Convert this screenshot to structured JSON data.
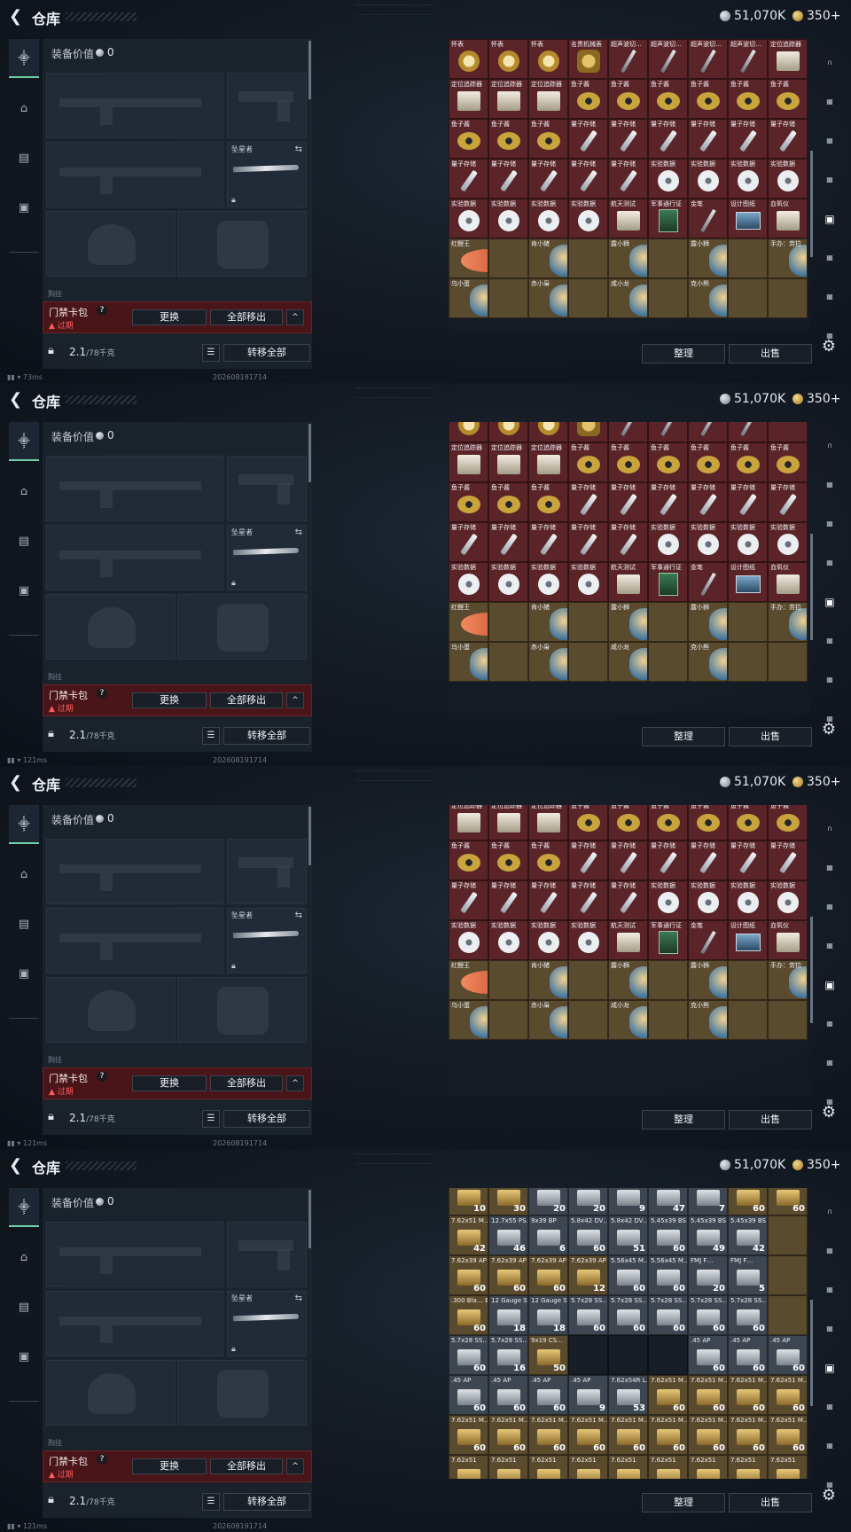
{
  "header": {
    "title": "仓库",
    "silver": "51,070K",
    "gold": "350+"
  },
  "rail": {
    "icons": [
      "gun-icon",
      "helmet-icon",
      "vest-icon",
      "briefcase-icon"
    ]
  },
  "equip": {
    "value_label": "装备价值",
    "value": "0",
    "knife_label": "坠星者",
    "faint_label": "胸挂",
    "card_name": "门禁卡包",
    "card_help": "?",
    "card_expired": "过期",
    "btn_replace": "更换",
    "btn_move_out_all": "全部移出",
    "btn_collapse": "^",
    "weight": "2.1",
    "weight_max": "/78千克",
    "btn_transfer_all": "转移全部"
  },
  "status": {
    "date": "20260819171​4"
  },
  "grid_buttons": {
    "sort": "整理",
    "sell": "出售"
  },
  "frames": [
    {
      "ping": "73ms",
      "offset": 14,
      "rows": [
        [
          [
            "怀表",
            "watch"
          ],
          [
            "怀表",
            "watch"
          ],
          [
            "怀表",
            "watch"
          ],
          [
            "名贵机械表",
            "gear"
          ],
          [
            "超声波切…",
            "pen"
          ],
          [
            "超声波切…",
            "pen"
          ],
          [
            "超声波切…",
            "pen"
          ],
          [
            "超声波切…",
            "pen"
          ],
          [
            "定位追踪器",
            "box"
          ]
        ],
        [
          [
            "定位追踪器",
            "box"
          ],
          [
            "定位追踪器",
            "box"
          ],
          [
            "定位追踪器",
            "box"
          ],
          [
            "鱼子酱",
            "ring"
          ],
          [
            "鱼子酱",
            "ring"
          ],
          [
            "鱼子酱",
            "ring"
          ],
          [
            "鱼子酱",
            "ring"
          ],
          [
            "鱼子酱",
            "ring"
          ],
          [
            "鱼子酱",
            "ring"
          ]
        ],
        [
          [
            "鱼子酱",
            "ring"
          ],
          [
            "鱼子酱",
            "ring"
          ],
          [
            "鱼子酱",
            "ring"
          ],
          [
            "量子存储",
            "stick"
          ],
          [
            "量子存储",
            "stick"
          ],
          [
            "量子存储",
            "stick"
          ],
          [
            "量子存储",
            "stick"
          ],
          [
            "量子存储",
            "stick"
          ],
          [
            "量子存储",
            "stick"
          ]
        ],
        [
          [
            "量子存储",
            "stick"
          ],
          [
            "量子存储",
            "stick"
          ],
          [
            "量子存储",
            "stick"
          ],
          [
            "量子存储",
            "stick"
          ],
          [
            "量子存储",
            "stick"
          ],
          [
            "实验数据",
            "disc"
          ],
          [
            "实验数据",
            "disc"
          ],
          [
            "实验数据",
            "disc"
          ],
          [
            "实验数据",
            "disc"
          ]
        ],
        [
          [
            "实验数据",
            "disc"
          ],
          [
            "实验数据",
            "disc"
          ],
          [
            "实验数据",
            "disc"
          ],
          [
            "实验数据",
            "disc"
          ],
          [
            "航天测试",
            "box"
          ],
          [
            "军事通行证",
            "green"
          ],
          [
            "金笔",
            "pen"
          ],
          [
            "设计图纸",
            "card"
          ],
          [
            "血氧仪",
            "box"
          ]
        ],
        [
          [
            "红鲤王",
            "fish",
            2
          ],
          [
            "",
            ""
          ],
          [
            "肯小猪",
            "fig",
            2
          ],
          [
            "",
            ""
          ],
          [
            "露小狮",
            "fig",
            2
          ],
          [
            "",
            ""
          ],
          [
            "露小狮",
            "fig",
            2
          ],
          [
            "",
            ""
          ],
          [
            "手办：劳拉",
            "fig"
          ]
        ],
        [
          [
            "乌小蛋",
            "fig",
            2
          ],
          [
            "",
            ""
          ],
          [
            "赤小枭",
            "fig",
            2
          ],
          [
            "",
            ""
          ],
          [
            "咸小龙",
            "fig",
            2
          ],
          [
            "",
            ""
          ],
          [
            "克小熊",
            "fig",
            2
          ],
          [
            "",
            ""
          ],
          [
            "",
            ""
          ]
        ]
      ]
    },
    {
      "ping": "121ms",
      "offset": -8,
      "rows": [
        [
          [
            "",
            "watch"
          ],
          [
            "",
            "watch"
          ],
          [
            "",
            "watch"
          ],
          [
            "",
            "gear"
          ],
          [
            "",
            "pen"
          ],
          [
            "",
            "pen"
          ],
          [
            "",
            "pen"
          ],
          [
            "",
            "pen"
          ],
          [
            "",
            ""
          ]
        ],
        [
          [
            "定位追踪器",
            "box"
          ],
          [
            "定位追踪器",
            "box"
          ],
          [
            "定位追踪器",
            "box"
          ],
          [
            "鱼子酱",
            "ring"
          ],
          [
            "鱼子酱",
            "ring"
          ],
          [
            "鱼子酱",
            "ring"
          ],
          [
            "鱼子酱",
            "ring"
          ],
          [
            "鱼子酱",
            "ring"
          ],
          [
            "鱼子酱",
            "ring"
          ]
        ],
        [
          [
            "鱼子酱",
            "ring"
          ],
          [
            "鱼子酱",
            "ring"
          ],
          [
            "鱼子酱",
            "ring"
          ],
          [
            "量子存储",
            "stick"
          ],
          [
            "量子存储",
            "stick"
          ],
          [
            "量子存储",
            "stick"
          ],
          [
            "量子存储",
            "stick"
          ],
          [
            "量子存储",
            "stick"
          ],
          [
            "量子存储",
            "stick"
          ]
        ],
        [
          [
            "量子存储",
            "stick"
          ],
          [
            "量子存储",
            "stick"
          ],
          [
            "量子存储",
            "stick"
          ],
          [
            "量子存储",
            "stick"
          ],
          [
            "量子存储",
            "stick"
          ],
          [
            "实验数据",
            "disc"
          ],
          [
            "实验数据",
            "disc"
          ],
          [
            "实验数据",
            "disc"
          ],
          [
            "实验数据",
            "disc"
          ]
        ],
        [
          [
            "实验数据",
            "disc"
          ],
          [
            "实验数据",
            "disc"
          ],
          [
            "实验数据",
            "disc"
          ],
          [
            "实验数据",
            "disc"
          ],
          [
            "航天测试",
            "box"
          ],
          [
            "军事通行证",
            "green"
          ],
          [
            "金笔",
            "pen"
          ],
          [
            "设计图纸",
            "card"
          ],
          [
            "血氧仪",
            "box"
          ]
        ],
        [
          [
            "红鲤王",
            "fish",
            2
          ],
          [
            "",
            ""
          ],
          [
            "肯小猪",
            "fig",
            2
          ],
          [
            "",
            ""
          ],
          [
            "露小狮",
            "fig",
            2
          ],
          [
            "",
            ""
          ],
          [
            "露小狮",
            "fig",
            2
          ],
          [
            "",
            ""
          ],
          [
            "手办：劳拉",
            "fig"
          ]
        ],
        [
          [
            "乌小蛋",
            "fig",
            2
          ],
          [
            "",
            ""
          ],
          [
            "赤小枭",
            "fig",
            2
          ],
          [
            "",
            ""
          ],
          [
            "咸小龙",
            "fig",
            2
          ],
          [
            "",
            ""
          ],
          [
            "克小熊",
            "fig",
            2
          ],
          [
            "",
            ""
          ],
          [
            "",
            ""
          ]
        ]
      ]
    },
    {
      "ping": "121ms",
      "offset": -36,
      "rows": [
        [
          [
            "",
            "watch"
          ],
          [
            "",
            "watch"
          ],
          [
            "",
            "watch"
          ],
          [
            "",
            "gear"
          ],
          [
            "",
            "pen"
          ],
          [
            "",
            "pen"
          ],
          [
            "",
            "pen"
          ],
          [
            "",
            "pen"
          ],
          [
            "",
            ""
          ]
        ],
        [
          [
            "定位追踪器",
            "box"
          ],
          [
            "定位追踪器",
            "box"
          ],
          [
            "定位追踪器",
            "box"
          ],
          [
            "鱼子酱",
            "ring"
          ],
          [
            "鱼子酱",
            "ring"
          ],
          [
            "鱼子酱",
            "ring"
          ],
          [
            "鱼子酱",
            "ring"
          ],
          [
            "鱼子酱",
            "ring"
          ],
          [
            "鱼子酱",
            "ring"
          ]
        ],
        [
          [
            "鱼子酱",
            "ring"
          ],
          [
            "鱼子酱",
            "ring"
          ],
          [
            "鱼子酱",
            "ring"
          ],
          [
            "量子存储",
            "stick"
          ],
          [
            "量子存储",
            "stick"
          ],
          [
            "量子存储",
            "stick"
          ],
          [
            "量子存储",
            "stick"
          ],
          [
            "量子存储",
            "stick"
          ],
          [
            "量子存储",
            "stick"
          ]
        ],
        [
          [
            "量子存储",
            "stick"
          ],
          [
            "量子存储",
            "stick"
          ],
          [
            "量子存储",
            "stick"
          ],
          [
            "量子存储",
            "stick"
          ],
          [
            "量子存储",
            "stick"
          ],
          [
            "实验数据",
            "disc"
          ],
          [
            "实验数据",
            "disc"
          ],
          [
            "实验数据",
            "disc"
          ],
          [
            "实验数据",
            "disc"
          ]
        ],
        [
          [
            "实验数据",
            "disc"
          ],
          [
            "实验数据",
            "disc"
          ],
          [
            "实验数据",
            "disc"
          ],
          [
            "实验数据",
            "disc"
          ],
          [
            "航天测试",
            "box"
          ],
          [
            "军事通行证",
            "green"
          ],
          [
            "金笔",
            "pen"
          ],
          [
            "设计图纸",
            "card"
          ],
          [
            "血氧仪",
            "box"
          ]
        ],
        [
          [
            "红鲤王",
            "fish",
            2
          ],
          [
            "",
            ""
          ],
          [
            "肯小猪",
            "fig",
            2
          ],
          [
            "",
            ""
          ],
          [
            "露小狮",
            "fig",
            2
          ],
          [
            "",
            ""
          ],
          [
            "露小狮",
            "fig",
            2
          ],
          [
            "",
            ""
          ],
          [
            "手办：劳拉",
            "fig"
          ]
        ],
        [
          [
            "乌小蛋",
            "fig",
            2
          ],
          [
            "",
            ""
          ],
          [
            "赤小枭",
            "fig",
            2
          ],
          [
            "",
            ""
          ],
          [
            "咸小龙",
            "fig",
            2
          ],
          [
            "",
            ""
          ],
          [
            "克小熊",
            "fig",
            2
          ],
          [
            "",
            ""
          ],
          [
            "",
            ""
          ]
        ]
      ]
    },
    {
      "ping": "121ms",
      "offset": 0,
      "ammo": true,
      "rows": [
        [
          [
            ".338 AP",
            "ammo",
            "10"
          ],
          [
            "7.62x51 M…",
            "ammo",
            "30"
          ],
          [
            "FTX F…",
            "ammo s",
            "20"
          ],
          [
            "FTX F…",
            "ammo s",
            "20"
          ],
          [
            "FTX F…",
            "ammo s",
            "9"
          ],
          [
            "4.6x30 AP",
            "ammo s",
            "47"
          ],
          [
            "7.62x54R B…",
            "ammo s",
            "7"
          ],
          [
            "7.62x51 M…",
            "ammo",
            "60"
          ],
          [
            "7.62x51 M…",
            "ammo",
            "60"
          ]
        ],
        [
          [
            "7.62x51 M…",
            "ammo",
            "42"
          ],
          [
            "12.7x55 PS…",
            "ammo s",
            "46"
          ],
          [
            "9x39 BP",
            "ammo s",
            "6"
          ],
          [
            "5.8x42 DV…",
            "ammo s",
            "60"
          ],
          [
            "5.8x42 DV…",
            "ammo s",
            "51"
          ],
          [
            "5.45x39 BS",
            "ammo s",
            "60"
          ],
          [
            "5.45x39 BS",
            "ammo s",
            "49"
          ],
          [
            "5.45x39 BS",
            "ammo s",
            "42"
          ],
          [
            "",
            ""
          ]
        ],
        [
          [
            "7.62x39 AP",
            "ammo",
            "60"
          ],
          [
            "7.62x39 AP",
            "ammo",
            "60"
          ],
          [
            "7.62x39 AP",
            "ammo",
            "60"
          ],
          [
            "7.62x39 AP",
            "ammo",
            "12"
          ],
          [
            "5.56x45 M…",
            "ammo s",
            "60"
          ],
          [
            "5.56x45 M…",
            "ammo s",
            "60"
          ],
          [
            "FMJ F…",
            "ammo s",
            "20"
          ],
          [
            "FMJ F…",
            "ammo s",
            "5"
          ],
          [
            "",
            ""
          ]
        ],
        [
          [
            ".300 Bla… BSSAR",
            "ammo",
            "60"
          ],
          [
            "12 Gauge S…",
            "ammo s",
            "18"
          ],
          [
            "12 Gauge S…",
            "ammo s",
            "18"
          ],
          [
            "5.7x28 SS…",
            "ammo s",
            "60"
          ],
          [
            "5.7x28 SS…",
            "ammo s",
            "60"
          ],
          [
            "5.7x28 SS…",
            "ammo s",
            "60"
          ],
          [
            "5.7x28 SS…",
            "ammo s",
            "60"
          ],
          [
            "5.7x28 SS…",
            "ammo s",
            "60"
          ],
          [
            "",
            ""
          ]
        ],
        [
          [
            "5.7x28 SS…",
            "ammo s",
            "60"
          ],
          [
            "5.7x28 SS…",
            "ammo s",
            "16"
          ],
          [
            "9x19 CS…",
            "ammo",
            "50"
          ],
          [
            "",
            "empty"
          ],
          [
            "",
            "empty"
          ],
          [
            "",
            "empty"
          ],
          [
            ".45 AP",
            "ammo s",
            "60"
          ],
          [
            ".45 AP",
            "ammo s",
            "60"
          ],
          [
            ".45 AP",
            "ammo s",
            "60"
          ]
        ],
        [
          [
            ".45 AP",
            "ammo s",
            "60"
          ],
          [
            ".45 AP",
            "ammo s",
            "60"
          ],
          [
            ".45 AP",
            "ammo s",
            "60"
          ],
          [
            ".45 AP",
            "ammo s",
            "9"
          ],
          [
            "7.62x54R L…",
            "ammo s",
            "53"
          ],
          [
            "7.62x51 M…",
            "ammo",
            "60"
          ],
          [
            "7.62x51 M…",
            "ammo",
            "60"
          ],
          [
            "7.62x51 M…",
            "ammo",
            "60"
          ],
          [
            "7.62x51 M…",
            "ammo",
            "60"
          ]
        ],
        [
          [
            "7.62x51 M…",
            "ammo",
            "60"
          ],
          [
            "7.62x51 M…",
            "ammo",
            "60"
          ],
          [
            "7.62x51 M…",
            "ammo",
            "60"
          ],
          [
            "7.62x51 M…",
            "ammo",
            "60"
          ],
          [
            "7.62x51 M…",
            "ammo",
            "60"
          ],
          [
            "7.62x51 M…",
            "ammo",
            "60"
          ],
          [
            "7.62x51 M…",
            "ammo",
            "60"
          ],
          [
            "7.62x51 M…",
            "ammo",
            "60"
          ],
          [
            "7.62x51 M…",
            "ammo",
            "60"
          ]
        ],
        [
          [
            "7.62x51",
            "ammo"
          ],
          [
            "7.62x51",
            "ammo"
          ],
          [
            "7.62x51",
            "ammo"
          ],
          [
            "7.62x51",
            "ammo"
          ],
          [
            "7.62x51",
            "ammo"
          ],
          [
            "7.62x51",
            "ammo"
          ],
          [
            "7.62x51",
            "ammo"
          ],
          [
            "7.62x51",
            "ammo"
          ],
          [
            "7.62x51",
            "ammo"
          ]
        ]
      ]
    }
  ]
}
